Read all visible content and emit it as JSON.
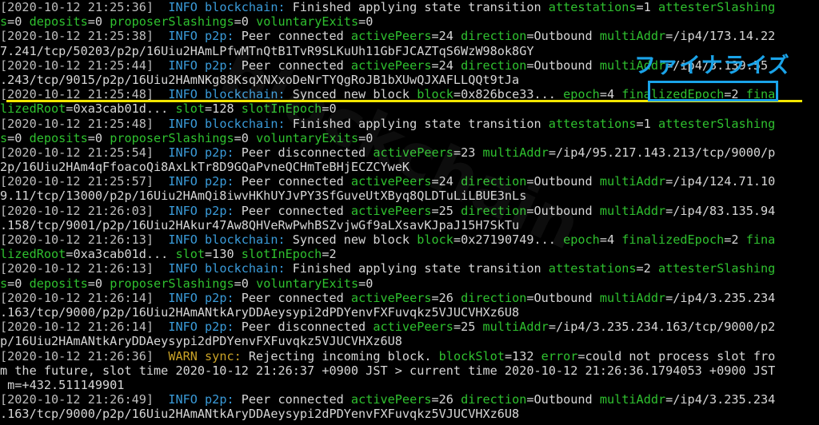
{
  "colors": {
    "background": "#000000",
    "timestamp": "#bdbdbd",
    "info_level": "#3a9bd9",
    "warn_level": "#c9a227",
    "key": "#2fc12f",
    "value": "#d6d6d6",
    "annotation_line": "#f2e600",
    "annotation_box": "#1aa3e8"
  },
  "annotation": {
    "label": "ファイナライズ"
  },
  "watermark": {
    "text": "blockchain"
  },
  "lines": [
    [
      [
        "ts",
        "[2020-10-12 21:25:36] "
      ],
      [
        "info",
        " INFO blockchain:"
      ],
      [
        "msg",
        " Finished applying state transition "
      ],
      [
        "k",
        "attestations"
      ],
      [
        "v",
        "=1 "
      ],
      [
        "k",
        "attesterSlashing"
      ]
    ],
    [
      [
        "k",
        "s"
      ],
      [
        "v",
        "=0 "
      ],
      [
        "k",
        "deposits"
      ],
      [
        "v",
        "=0 "
      ],
      [
        "k",
        "proposerSlashings"
      ],
      [
        "v",
        "=0 "
      ],
      [
        "k",
        "voluntaryExits"
      ],
      [
        "v",
        "=0"
      ]
    ],
    [
      [
        "ts",
        "[2020-10-12 21:25:38] "
      ],
      [
        "info",
        " INFO p2p:"
      ],
      [
        "msg",
        " Peer connected "
      ],
      [
        "k",
        "activePeers"
      ],
      [
        "v",
        "=24 "
      ],
      [
        "k",
        "direction"
      ],
      [
        "v",
        "=Outbound "
      ],
      [
        "k",
        "multiAddr"
      ],
      [
        "v",
        "=/ip4/173.14.22"
      ]
    ],
    [
      [
        "v",
        "7.241/tcp/50203/p2p/16Uiu2HAmLPfwMTnQtB1TvR9SLKuUh11GbFJCAZTqS6WzW98ok8GY"
      ]
    ],
    [
      [
        "ts",
        "[2020-10-12 21:25:44] "
      ],
      [
        "info",
        " INFO p2p:"
      ],
      [
        "msg",
        " Peer connected "
      ],
      [
        "k",
        "activePeers"
      ],
      [
        "v",
        "=24 "
      ],
      [
        "k",
        "direction"
      ],
      [
        "v",
        "=Outbound "
      ],
      [
        "k",
        "multiAddr"
      ],
      [
        "v",
        "=/ip4/3.139.55"
      ]
    ],
    [
      [
        "v",
        ".243/tcp/9015/p2p/16Uiu2HAmNKg88KsqXNXxoDeNrTYQgRoJB1bXUwQJXAFLLQQt9tJa"
      ]
    ],
    [
      [
        "ts",
        "[2020-10-12 21:25:48] "
      ],
      [
        "info",
        " INFO blockchain:"
      ],
      [
        "msg",
        " Synced new block "
      ],
      [
        "k",
        "block"
      ],
      [
        "v",
        "=0x826bce33... "
      ],
      [
        "k",
        "epoch"
      ],
      [
        "v",
        "=4 "
      ],
      [
        "k",
        "finalizedEpoch"
      ],
      [
        "v",
        "=2 "
      ],
      [
        "k",
        "fina"
      ]
    ],
    [
      [
        "k",
        "lizedRoot"
      ],
      [
        "v",
        "=0xa3cab01d... "
      ],
      [
        "k",
        "slot"
      ],
      [
        "v",
        "=128 "
      ],
      [
        "k",
        "slotInEpoch"
      ],
      [
        "v",
        "=0"
      ]
    ],
    [
      [
        "ts",
        "[2020-10-12 21:25:48] "
      ],
      [
        "info",
        " INFO blockchain:"
      ],
      [
        "msg",
        " Finished applying state transition "
      ],
      [
        "k",
        "attestations"
      ],
      [
        "v",
        "=1 "
      ],
      [
        "k",
        "attesterSlashing"
      ]
    ],
    [
      [
        "k",
        "s"
      ],
      [
        "v",
        "=0 "
      ],
      [
        "k",
        "deposits"
      ],
      [
        "v",
        "=0 "
      ],
      [
        "k",
        "proposerSlashings"
      ],
      [
        "v",
        "=0 "
      ],
      [
        "k",
        "voluntaryExits"
      ],
      [
        "v",
        "=0"
      ]
    ],
    [
      [
        "ts",
        "[2020-10-12 21:25:54] "
      ],
      [
        "info",
        " INFO p2p:"
      ],
      [
        "msg",
        " Peer disconnected "
      ],
      [
        "k",
        "activePeers"
      ],
      [
        "v",
        "=23 "
      ],
      [
        "k",
        "multiAddr"
      ],
      [
        "v",
        "=/ip4/95.217.143.213/tcp/9000/p"
      ]
    ],
    [
      [
        "v",
        "2p/16Uiu2HAm4qFfoacoQi8AxLkTr8D9GQaPvneQCHmTeBHjECZCYweK"
      ]
    ],
    [
      [
        "ts",
        "[2020-10-12 21:25:57] "
      ],
      [
        "info",
        " INFO p2p:"
      ],
      [
        "msg",
        " Peer connected "
      ],
      [
        "k",
        "activePeers"
      ],
      [
        "v",
        "=24 "
      ],
      [
        "k",
        "direction"
      ],
      [
        "v",
        "=Outbound "
      ],
      [
        "k",
        "multiAddr"
      ],
      [
        "v",
        "=/ip4/124.71.10"
      ]
    ],
    [
      [
        "v",
        "9.11/tcp/13000/p2p/16Uiu2HAmQi8iwvHKhUYJvPY3SfGuveUtXByq8QLDTuLiLBUE3nLs"
      ]
    ],
    [
      [
        "ts",
        "[2020-10-12 21:26:03] "
      ],
      [
        "info",
        " INFO p2p:"
      ],
      [
        "msg",
        " Peer connected "
      ],
      [
        "k",
        "activePeers"
      ],
      [
        "v",
        "=25 "
      ],
      [
        "k",
        "direction"
      ],
      [
        "v",
        "=Outbound "
      ],
      [
        "k",
        "multiAddr"
      ],
      [
        "v",
        "=/ip4/83.135.94"
      ]
    ],
    [
      [
        "v",
        ".158/tcp/9001/p2p/16Uiu2HAkur47Aw8QHVeRwPwhBSZvjwGf9aLXsavKJpaJ15H7SkTu"
      ]
    ],
    [
      [
        "ts",
        "[2020-10-12 21:26:13] "
      ],
      [
        "info",
        " INFO blockchain:"
      ],
      [
        "msg",
        " Synced new block "
      ],
      [
        "k",
        "block"
      ],
      [
        "v",
        "=0x27190749... "
      ],
      [
        "k",
        "epoch"
      ],
      [
        "v",
        "=4 "
      ],
      [
        "k",
        "finalizedEpoch"
      ],
      [
        "v",
        "=2 "
      ],
      [
        "k",
        "fina"
      ]
    ],
    [
      [
        "k",
        "lizedRoot"
      ],
      [
        "v",
        "=0xa3cab01d... "
      ],
      [
        "k",
        "slot"
      ],
      [
        "v",
        "=130 "
      ],
      [
        "k",
        "slotInEpoch"
      ],
      [
        "v",
        "=2"
      ]
    ],
    [
      [
        "ts",
        "[2020-10-12 21:26:13] "
      ],
      [
        "info",
        " INFO blockchain:"
      ],
      [
        "msg",
        " Finished applying state transition "
      ],
      [
        "k",
        "attestations"
      ],
      [
        "v",
        "=2 "
      ],
      [
        "k",
        "attesterSlashing"
      ]
    ],
    [
      [
        "k",
        "s"
      ],
      [
        "v",
        "=0 "
      ],
      [
        "k",
        "deposits"
      ],
      [
        "v",
        "=0 "
      ],
      [
        "k",
        "proposerSlashings"
      ],
      [
        "v",
        "=0 "
      ],
      [
        "k",
        "voluntaryExits"
      ],
      [
        "v",
        "=0"
      ]
    ],
    [
      [
        "ts",
        "[2020-10-12 21:26:14] "
      ],
      [
        "info",
        " INFO p2p:"
      ],
      [
        "msg",
        " Peer connected "
      ],
      [
        "k",
        "activePeers"
      ],
      [
        "v",
        "=26 "
      ],
      [
        "k",
        "direction"
      ],
      [
        "v",
        "=Outbound "
      ],
      [
        "k",
        "multiAddr"
      ],
      [
        "v",
        "=/ip4/3.235.234"
      ]
    ],
    [
      [
        "v",
        ".163/tcp/9000/p2p/16Uiu2HAmANtkAryDDAeysypi2dPDYenvFXFuvqkz5VJUCVHXz6U8"
      ]
    ],
    [
      [
        "ts",
        "[2020-10-12 21:26:14] "
      ],
      [
        "info",
        " INFO p2p:"
      ],
      [
        "msg",
        " Peer disconnected "
      ],
      [
        "k",
        "activePeers"
      ],
      [
        "v",
        "=25 "
      ],
      [
        "k",
        "multiAddr"
      ],
      [
        "v",
        "=/ip4/3.235.234.163/tcp/9000/p2"
      ]
    ],
    [
      [
        "v",
        "p/16Uiu2HAmANtkAryDDAeysypi2dPDYenvFXFuvqkz5VJUCVHXz6U8"
      ]
    ],
    [
      [
        "ts",
        "[2020-10-12 21:26:36] "
      ],
      [
        "warn",
        " WARN sync:"
      ],
      [
        "msg",
        " Rejecting incoming block. "
      ],
      [
        "k",
        "blockSlot"
      ],
      [
        "v",
        "=132 "
      ],
      [
        "k",
        "error"
      ],
      [
        "v",
        "=could not process slot fro"
      ]
    ],
    [
      [
        "v",
        "m the future, slot time 2020-10-12 21:26:37 +0900 JST > current time 2020-10-12 21:26:36.1794053 +0900 JST"
      ]
    ],
    [
      [
        "v",
        " m=+432.511149901"
      ]
    ],
    [
      [
        "ts",
        "[2020-10-12 21:26:49] "
      ],
      [
        "info",
        " INFO p2p:"
      ],
      [
        "msg",
        " Peer connected "
      ],
      [
        "k",
        "activePeers"
      ],
      [
        "v",
        "=26 "
      ],
      [
        "k",
        "direction"
      ],
      [
        "v",
        "=Outbound "
      ],
      [
        "k",
        "multiAddr"
      ],
      [
        "v",
        "=/ip4/3.235.234"
      ]
    ],
    [
      [
        "v",
        ".163/tcp/9000/p2p/16Uiu2HAmANtkAryDDAeysypi2dPDYenvFXFuvqkz5VJUCVHXz6U8"
      ]
    ]
  ]
}
